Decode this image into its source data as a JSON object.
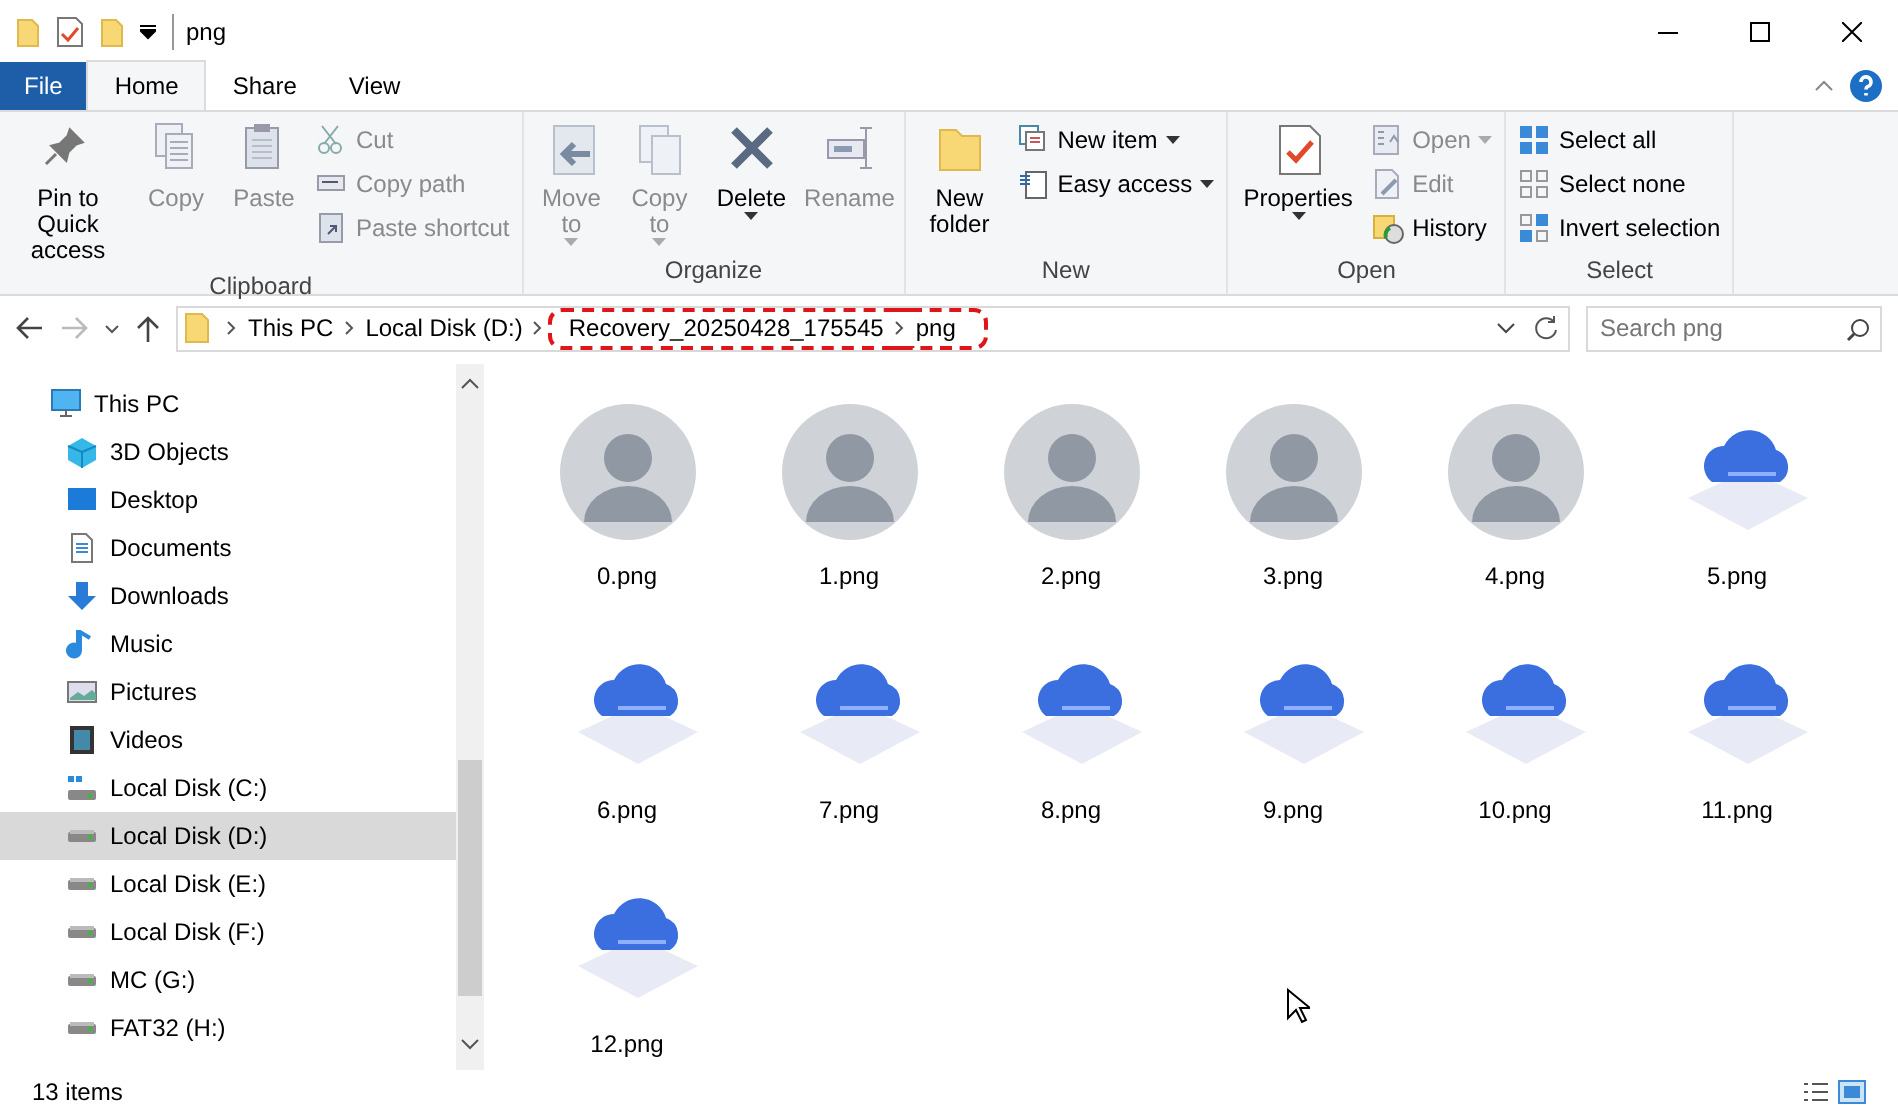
{
  "window": {
    "title": "png"
  },
  "ribbon_tabs": [
    {
      "label": "File",
      "kind": "file",
      "selected": false
    },
    {
      "label": "Home",
      "kind": "tab",
      "selected": true
    },
    {
      "label": "Share",
      "kind": "tab",
      "selected": false
    },
    {
      "label": "View",
      "kind": "tab",
      "selected": false
    }
  ],
  "ribbon_groups": [
    {
      "title": "Clipboard",
      "items": [
        {
          "label": "Pin to Quick access",
          "kind": "large",
          "disabled": false,
          "dropdown": false
        },
        {
          "label": "Copy",
          "kind": "large",
          "disabled": true,
          "dropdown": false
        },
        {
          "label": "Paste",
          "kind": "large",
          "disabled": true,
          "dropdown": false
        },
        {
          "label": "Cut",
          "kind": "small",
          "disabled": true,
          "dropdown": false
        },
        {
          "label": "Copy path",
          "kind": "small",
          "disabled": true,
          "dropdown": false
        },
        {
          "label": "Paste shortcut",
          "kind": "small",
          "disabled": true,
          "dropdown": false
        }
      ]
    },
    {
      "title": "Organize",
      "items": [
        {
          "label": "Move to",
          "kind": "large",
          "disabled": true,
          "dropdown": true
        },
        {
          "label": "Copy to",
          "kind": "large",
          "disabled": true,
          "dropdown": true
        },
        {
          "label": "Delete",
          "kind": "large",
          "disabled": false,
          "dropdown": true
        },
        {
          "label": "Rename",
          "kind": "large",
          "disabled": true,
          "dropdown": false
        }
      ]
    },
    {
      "title": "New",
      "items": [
        {
          "label": "New folder",
          "kind": "large",
          "disabled": false,
          "dropdown": false
        },
        {
          "label": "New item",
          "kind": "small",
          "disabled": false,
          "dropdown": true
        },
        {
          "label": "Easy access",
          "kind": "small",
          "disabled": false,
          "dropdown": true
        }
      ]
    },
    {
      "title": "Open",
      "items": [
        {
          "label": "Properties",
          "kind": "large",
          "disabled": false,
          "dropdown": true
        },
        {
          "label": "Open",
          "kind": "small",
          "disabled": true,
          "dropdown": true
        },
        {
          "label": "Edit",
          "kind": "small",
          "disabled": true,
          "dropdown": false
        },
        {
          "label": "History",
          "kind": "small",
          "disabled": false,
          "dropdown": false
        }
      ]
    },
    {
      "title": "Select",
      "items": [
        {
          "label": "Select all",
          "kind": "small",
          "disabled": false,
          "dropdown": false
        },
        {
          "label": "Select none",
          "kind": "small",
          "disabled": false,
          "dropdown": false
        },
        {
          "label": "Invert selection",
          "kind": "small",
          "disabled": false,
          "dropdown": false
        }
      ]
    }
  ],
  "address_bar": {
    "breadcrumbs": [
      {
        "label": "This PC",
        "highlighted": false
      },
      {
        "label": "Local Disk (D:)",
        "highlighted": false
      },
      {
        "label": "Recovery_20250428_175545",
        "highlighted": true
      },
      {
        "label": "png",
        "highlighted": true
      }
    ],
    "search_placeholder": "Search png"
  },
  "sidebar": {
    "items": [
      {
        "label": "This PC",
        "selected": false,
        "children": [
          {
            "label": "3D Objects",
            "selected": false
          },
          {
            "label": "Desktop",
            "selected": false
          },
          {
            "label": "Documents",
            "selected": false
          },
          {
            "label": "Downloads",
            "selected": false
          },
          {
            "label": "Music",
            "selected": false
          },
          {
            "label": "Pictures",
            "selected": false
          },
          {
            "label": "Videos",
            "selected": false
          },
          {
            "label": "Local Disk (C:)",
            "selected": false
          },
          {
            "label": "Local Disk (D:)",
            "selected": true
          },
          {
            "label": "Local Disk (E:)",
            "selected": false
          },
          {
            "label": "Local Disk (F:)",
            "selected": false
          },
          {
            "label": "MC (G:)",
            "selected": false
          },
          {
            "label": "FAT32 (H:)",
            "selected": false
          }
        ]
      }
    ]
  },
  "files": [
    {
      "name": "0.png",
      "kind": "photo"
    },
    {
      "name": "1.png",
      "kind": "photo"
    },
    {
      "name": "2.png",
      "kind": "photo"
    },
    {
      "name": "3.png",
      "kind": "photo"
    },
    {
      "name": "4.png",
      "kind": "photo"
    },
    {
      "name": "5.png",
      "kind": "illustration"
    },
    {
      "name": "6.png",
      "kind": "illustration"
    },
    {
      "name": "7.png",
      "kind": "illustration"
    },
    {
      "name": "8.png",
      "kind": "illustration"
    },
    {
      "name": "9.png",
      "kind": "illustration"
    },
    {
      "name": "10.png",
      "kind": "illustration"
    },
    {
      "name": "11.png",
      "kind": "illustration"
    },
    {
      "name": "12.png",
      "kind": "illustration"
    }
  ],
  "status_bar": {
    "item_count": "13 items"
  }
}
